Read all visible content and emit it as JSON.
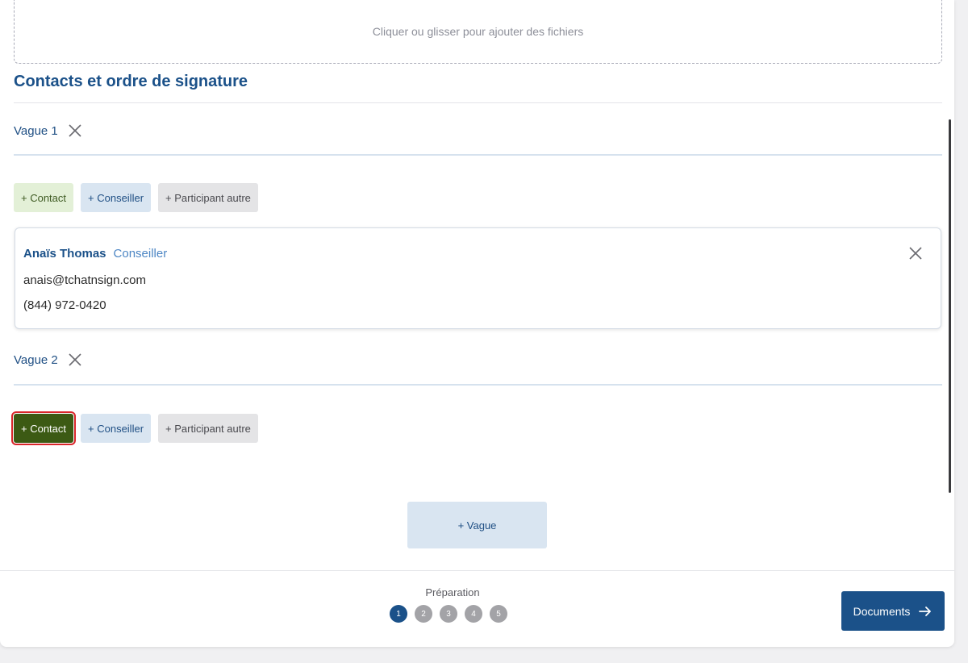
{
  "dropzone": {
    "text": "Cliquer ou glisser pour ajouter des fichiers"
  },
  "section": {
    "title": "Contacts et ordre de signature"
  },
  "waves": [
    {
      "label": "Vague 1",
      "buttons": {
        "contact": "+ Contact",
        "conseiller": "+ Conseiller",
        "autre": "+ Participant autre"
      },
      "participant": {
        "name": "Anaïs Thomas",
        "role": "Conseiller",
        "email": "anais@tchatnsign.com",
        "phone": "(844) 972-0420"
      }
    },
    {
      "label": "Vague 2",
      "buttons": {
        "contact": "+ Contact",
        "conseiller": "+ Conseiller",
        "autre": "+ Participant autre"
      }
    }
  ],
  "add_wave": "+ Vague",
  "footer": {
    "step_label": "Préparation",
    "steps": [
      "1",
      "2",
      "3",
      "4",
      "5"
    ],
    "current_step": 1,
    "next_label": "Documents"
  },
  "icons": {
    "close": "close-icon",
    "arrow": "arrow-right-icon"
  },
  "colors": {
    "brand": "#1b5189",
    "contact_active": "#3c5a14",
    "highlight": "#d9262b"
  }
}
